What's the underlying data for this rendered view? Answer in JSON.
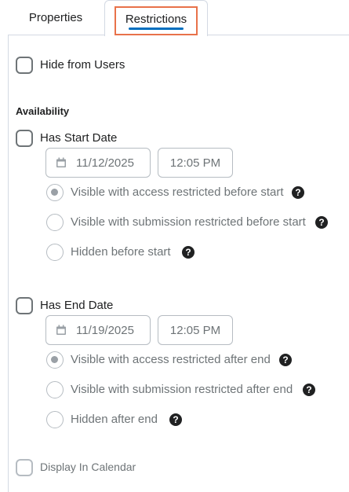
{
  "tabs": {
    "properties": "Properties",
    "restrictions": "Restrictions",
    "active": "Restrictions"
  },
  "hide_from_users": {
    "label": "Hide from Users",
    "checked": false
  },
  "availability": {
    "heading": "Availability",
    "start": {
      "label": "Has Start Date",
      "checked": false,
      "date": "11/12/2025",
      "time": "12:05 PM",
      "options": [
        {
          "label": "Visible with access restricted before start",
          "selected": true
        },
        {
          "label": "Visible with submission restricted before start",
          "selected": false
        },
        {
          "label": "Hidden before start",
          "selected": false
        }
      ]
    },
    "end": {
      "label": "Has End Date",
      "checked": false,
      "date": "11/19/2025",
      "time": "12:05 PM",
      "options": [
        {
          "label": "Visible with access restricted after end",
          "selected": true
        },
        {
          "label": "Visible with submission restricted after end",
          "selected": false
        },
        {
          "label": "Hidden after end",
          "selected": false
        }
      ]
    }
  },
  "display_in_calendar": {
    "label": "Display In Calendar",
    "checked": false,
    "enabled": false
  },
  "icons": {
    "help": "help-icon",
    "calendar": "calendar-icon"
  },
  "colors": {
    "tab_highlight": "#e8724a",
    "tab_underline": "#006fbf",
    "disabled_text": "#6e7477"
  }
}
